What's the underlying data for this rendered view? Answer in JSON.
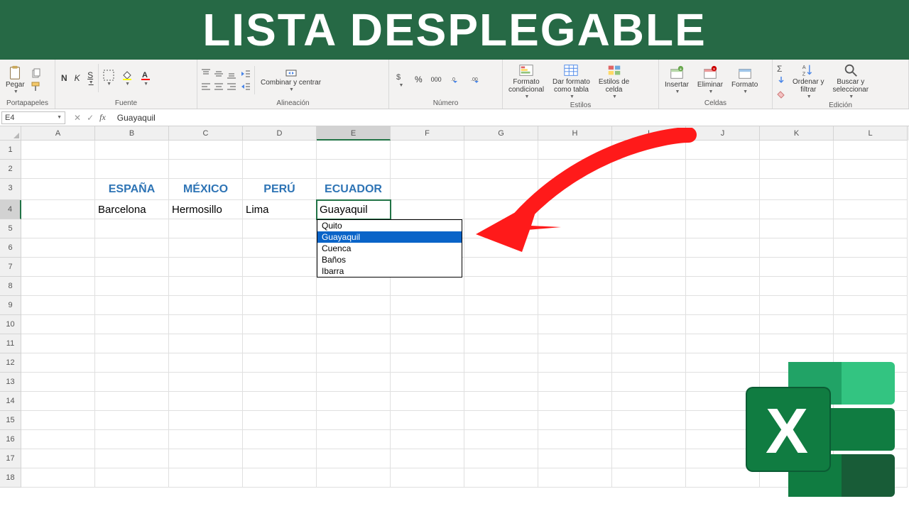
{
  "banner": {
    "title": "LISTA DESPLEGABLE"
  },
  "ribbon": {
    "groups": {
      "clipboard": {
        "label": "Portapapeles",
        "paste": "Pegar"
      },
      "font": {
        "label": "Fuente",
        "bold": "N",
        "italic": "K",
        "underline": "S"
      },
      "alignment": {
        "label": "Alineación",
        "merge": "Combinar y centrar"
      },
      "number": {
        "label": "Número"
      },
      "styles": {
        "label": "Estilos",
        "cond": "Formato\ncondicional",
        "table": "Dar formato\ncomo tabla",
        "cellstyle": "Estilos de\ncelda"
      },
      "cells": {
        "label": "Celdas",
        "insert": "Insertar",
        "delete": "Eliminar",
        "format": "Formato"
      },
      "editing": {
        "label": "Edición",
        "sort": "Ordenar y\nfiltrar",
        "find": "Buscar y\nseleccionar"
      }
    }
  },
  "formula_bar": {
    "cell_ref": "E4",
    "value": "Guayaquil"
  },
  "grid": {
    "columns": [
      "A",
      "B",
      "C",
      "D",
      "E",
      "F",
      "G",
      "H",
      "I",
      "J",
      "K",
      "L"
    ],
    "active_col": "E",
    "active_row": 4,
    "row_count": 18,
    "headers": {
      "B": "ESPAÑA",
      "C": "MÉXICO",
      "D": "PERÚ",
      "E": "ECUADOR"
    },
    "data_row": {
      "B": "Barcelona",
      "C": "Hermosillo",
      "D": "Lima",
      "E": "Guayaquil"
    },
    "dropdown": {
      "options": [
        "Quito",
        "Guayaquil",
        "Cuenca",
        "Baños",
        "Ibarra"
      ],
      "selected": "Guayaquil"
    }
  },
  "icons": {
    "percent": "%",
    "thousands": "000"
  }
}
